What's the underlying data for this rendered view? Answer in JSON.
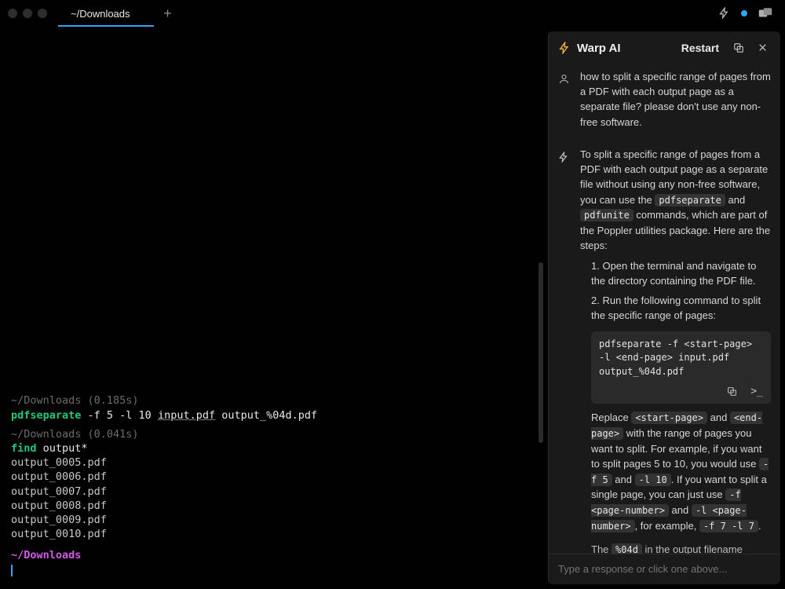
{
  "titlebar": {
    "tab_title": "~/Downloads"
  },
  "terminal": {
    "blocks": [
      {
        "header": "~/Downloads (0.185s)",
        "program": "pdfseparate",
        "rest_before_under": " -f 5 -l 10 ",
        "under": "input.pdf",
        "rest_after_under": " output_%04d.pdf",
        "output": []
      },
      {
        "header": "~/Downloads (0.041s)",
        "program": "find",
        "rest_before_under": " output*",
        "under": "",
        "rest_after_under": "",
        "output": [
          "output_0005.pdf",
          "output_0006.pdf",
          "output_0007.pdf",
          "output_0008.pdf",
          "output_0009.pdf",
          "output_0010.pdf"
        ]
      }
    ],
    "prompt": "~/Downloads"
  },
  "ai": {
    "title": "Warp AI",
    "restart": "Restart",
    "user_msg": "how to split a specific range of pages from a PDF with each output page as a separate file? please don't use any non-free software.",
    "assistant": {
      "intro_1": "To split a specific range of pages from a PDF with each output page as a separate file without using any non-free software, you can use the ",
      "code_a": "pdfseparate",
      "intro_2": " and ",
      "code_b": "pdfunite",
      "intro_3": " commands, which are part of the Poppler utilities package. Here are the steps:",
      "step1": "1. Open the terminal and navigate to the directory containing the PDF file.",
      "step2": "2. Run the following command to split the specific range of pages:",
      "codeblock": "pdfseparate -f <start-page> -l <end-page> input.pdf output_%04d.pdf",
      "para_1": "Replace ",
      "para_c1": "<start-page>",
      "para_2": " and ",
      "para_c2": "<end-page>",
      "para_3": " with the range of pages you want to split. For example, if you want to split pages 5 to 10, you would use ",
      "para_c3": "-f 5",
      "para_4": " and ",
      "para_c4": "-l 10",
      "para_5": ". If you want to split a single page, you can just use ",
      "para_c5": "-f <page-number>",
      "para_6": " and ",
      "para_c6": "-l <page-number>",
      "para_7": ", for example, ",
      "para_c7": "-f 7 -l 7",
      "para_8": ".",
      "trail_1": "The ",
      "trail_c1": "%04d",
      "trail_2": " in the output filename"
    },
    "input_placeholder": "Type a response or click one above..."
  }
}
